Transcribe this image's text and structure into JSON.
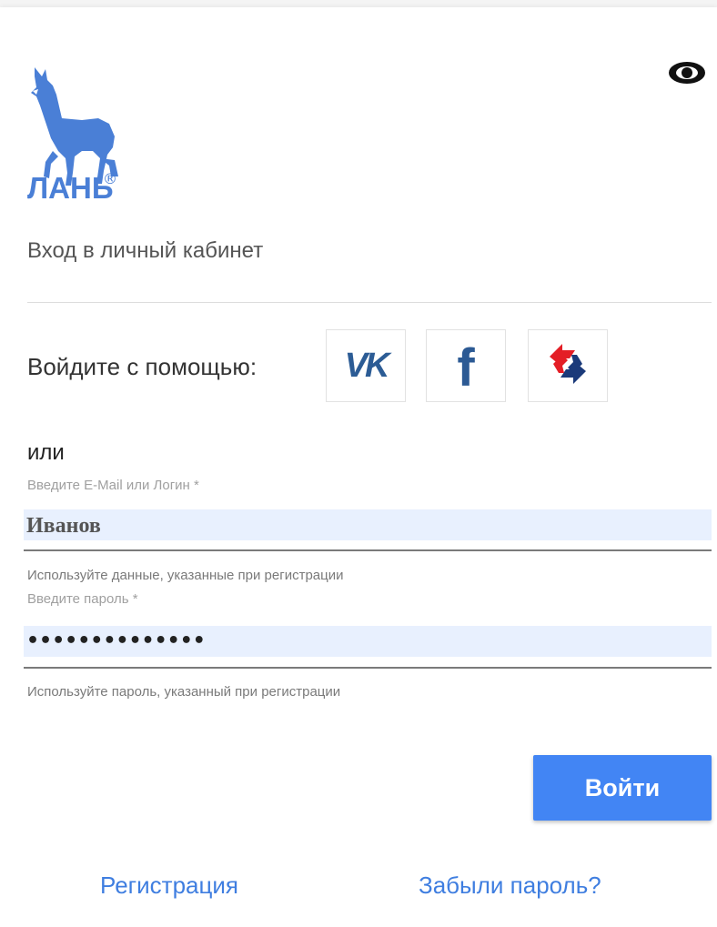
{
  "brand": {
    "name": "ЛАНЬ",
    "registered_mark": "®",
    "logo_icon": "doe-deer-logo",
    "color": "#4a7fd6"
  },
  "header": {
    "visibility_icon": "eye-icon"
  },
  "subtitle": "Вход в личный кабинет",
  "social": {
    "label": "Войдите с помощью:",
    "providers": [
      {
        "id": "vk",
        "glyph": "VK",
        "icon": "vk-icon",
        "color": "#2c5c95"
      },
      {
        "id": "facebook",
        "glyph": "f",
        "icon": "facebook-icon",
        "color": "#2c5a94"
      },
      {
        "id": "other",
        "glyph": "",
        "icon": "red-blue-arrows-icon",
        "colors": [
          "#e41e26",
          "#1b3a7a"
        ]
      }
    ]
  },
  "or_text": "или",
  "form": {
    "login": {
      "label": "Введите E-Mail или Логин *",
      "value": "Иванов",
      "hint": "Используйте данные, указанные при регистрации"
    },
    "password": {
      "label": "Введите пароль *",
      "value": "••••••••••••••",
      "hint": "Используйте пароль, указанный при регистрации"
    },
    "submit_label": "Войти",
    "submit_color": "#4285f4",
    "input_background": "#e8f0fe"
  },
  "links": {
    "register": "Регистрация",
    "forgot": "Забыли пароль?",
    "color": "#3f7ee0"
  }
}
